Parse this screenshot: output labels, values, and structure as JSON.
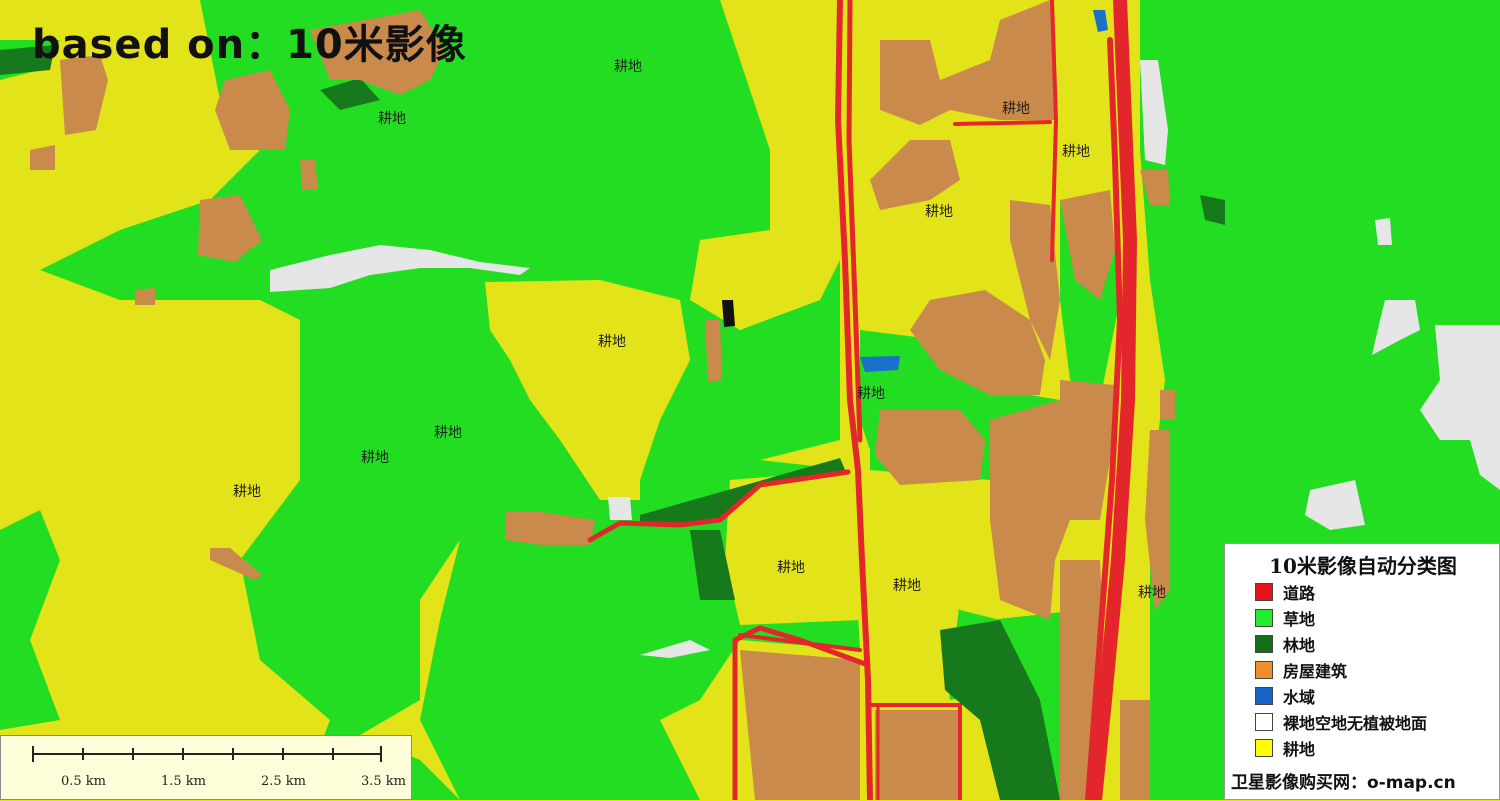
{
  "title": "based on：10米影像",
  "place_label": "耕地",
  "scale_bar": {
    "ticks": [
      "0.5 km",
      "1.5 km",
      "2.5 km",
      "3.5 km"
    ]
  },
  "legend": {
    "title": "10米影像自动分类图",
    "items": [
      {
        "label": "道路",
        "color": "#e8141c"
      },
      {
        "label": "草地",
        "color": "#22ee2e"
      },
      {
        "label": "林地",
        "color": "#137018"
      },
      {
        "label": "房屋建筑",
        "color": "#f08d2e"
      },
      {
        "label": "水域",
        "color": "#1563c8"
      },
      {
        "label": "裸地空地无植被地面",
        "color": "#ffffff"
      },
      {
        "label": "耕地",
        "color": "#ffff00"
      }
    ],
    "footer": "卫星影像购买网：o-map.cn"
  },
  "colors": {
    "cropland": "#e3e31a",
    "grassland": "#22dd22",
    "forest": "#167a1c",
    "building": "#c98a4c",
    "road": "#e3262c",
    "water": "#1b70c9",
    "bare": "#e6e6e6"
  }
}
